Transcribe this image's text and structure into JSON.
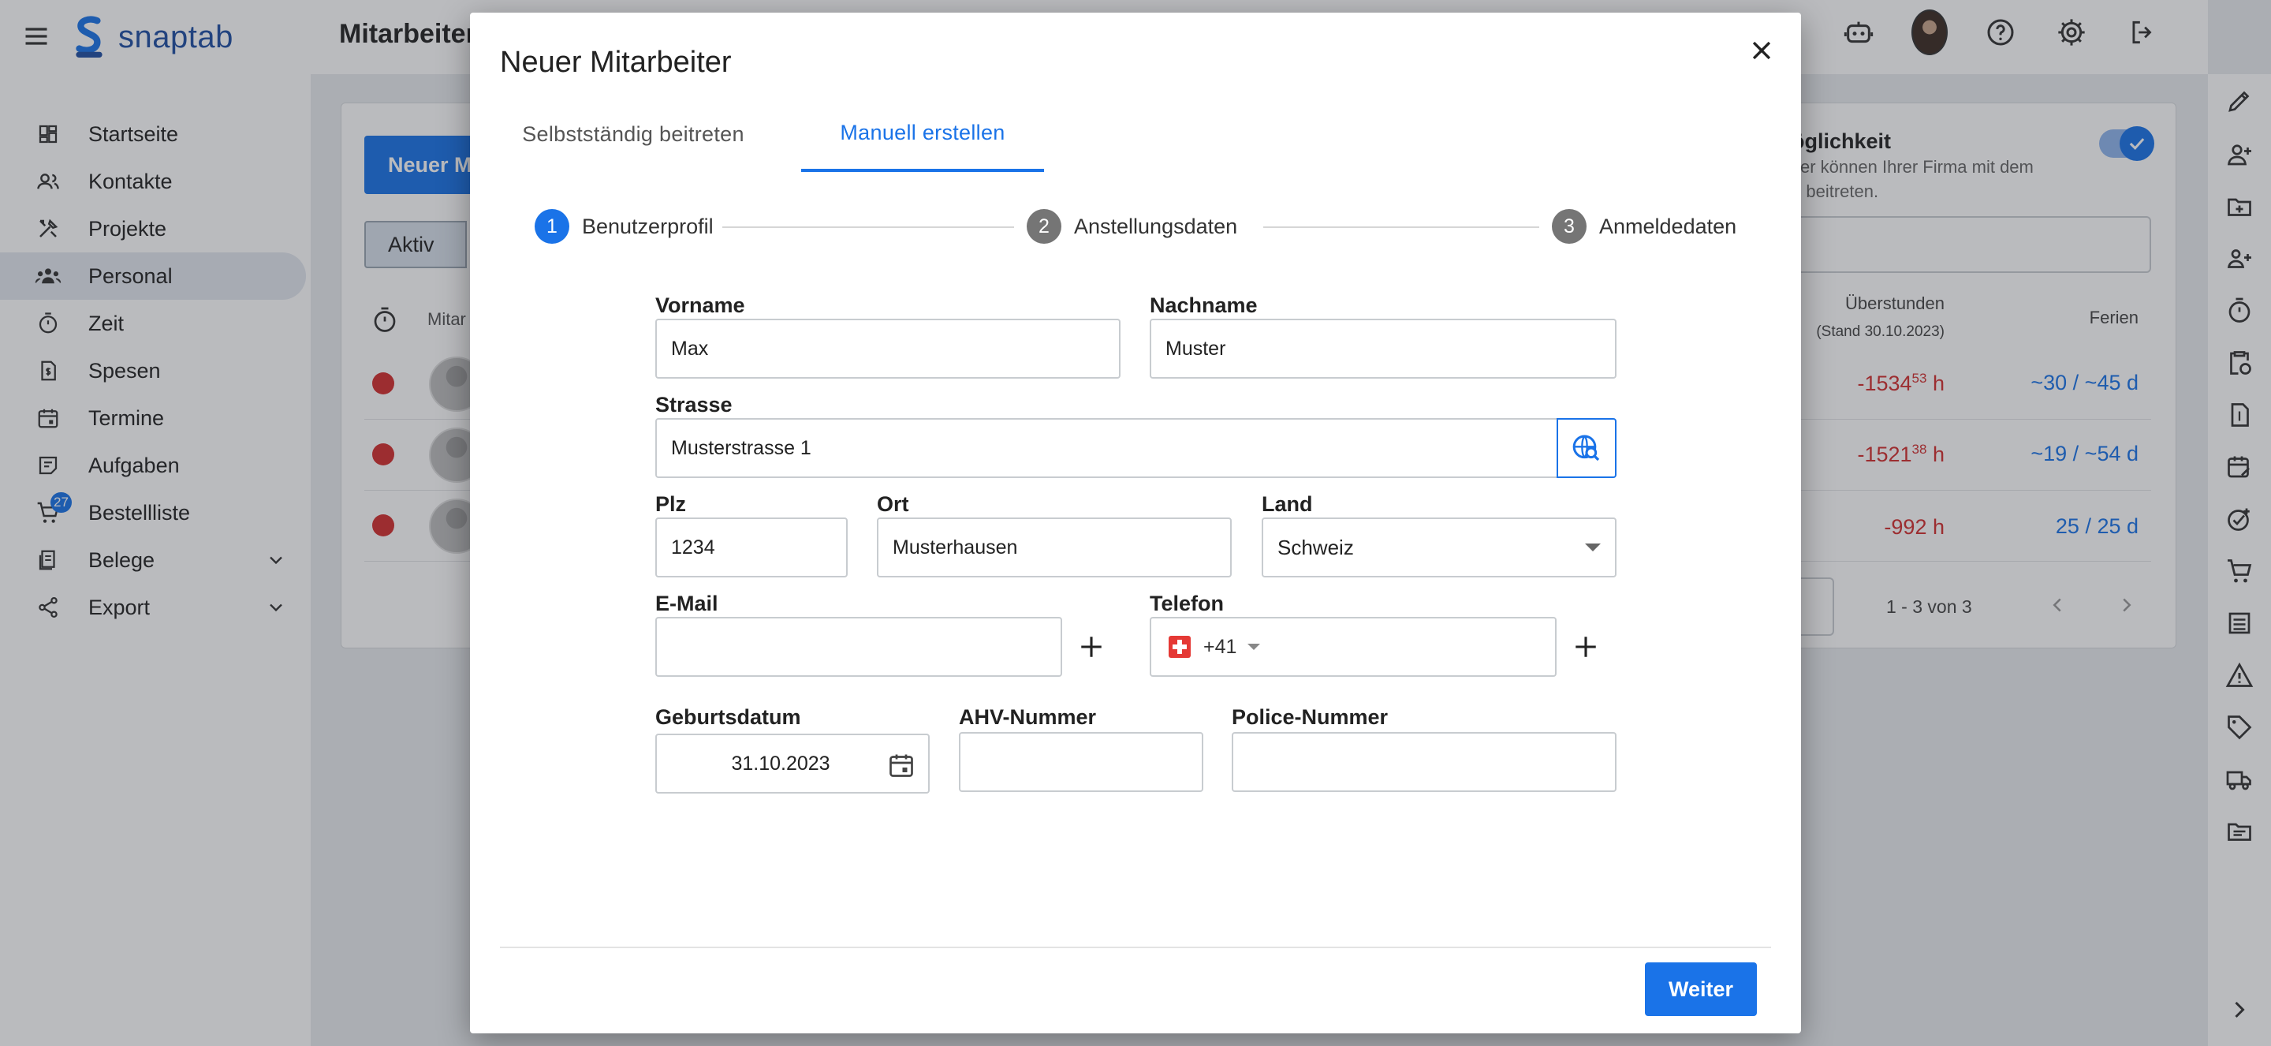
{
  "app": {
    "brand": "snaptab",
    "page_title": "Mitarbeiter",
    "accent_color": "#1a73e8"
  },
  "topbar": {
    "icons": [
      "bell-icon",
      "robot-icon",
      "user-avatar",
      "help-icon",
      "gear-icon",
      "logout-icon"
    ]
  },
  "sidebar": {
    "items": [
      {
        "label": "Startseite",
        "icon": "dashboard-icon"
      },
      {
        "label": "Kontakte",
        "icon": "contacts-icon"
      },
      {
        "label": "Projekte",
        "icon": "tools-icon"
      },
      {
        "label": "Personal",
        "icon": "people-icon"
      },
      {
        "label": "Zeit",
        "icon": "stopwatch-icon"
      },
      {
        "label": "Spesen",
        "icon": "receipt-icon"
      },
      {
        "label": "Termine",
        "icon": "calendar-icon"
      },
      {
        "label": "Aufgaben",
        "icon": "tasks-icon"
      },
      {
        "label": "Bestellliste",
        "icon": "cart-icon",
        "badge": "27"
      },
      {
        "label": "Belege",
        "icon": "documents-icon"
      },
      {
        "label": "Export",
        "icon": "share-icon"
      }
    ]
  },
  "background": {
    "new_button": "Neuer M",
    "segment_active": "Aktiv",
    "col_employee": "Mitar",
    "join_title": "öglichkeit",
    "join_text_1": "zer können Ihrer Firma mit dem",
    "join_text_2": "e beitreten.",
    "th_overtime": "Überstunden",
    "th_overtime_stand": "(Stand 30.10.2023)",
    "th_vacation": "Ferien",
    "rows": [
      {
        "hours": "-1534",
        "hours_sup": "53",
        "hours_unit": " h",
        "vacation": "~30 / ~45 d"
      },
      {
        "hours": "-1521",
        "hours_sup": "38",
        "hours_unit": " h",
        "vacation": "~19 / ~54 d"
      },
      {
        "hours": "-992",
        "hours_sup": "",
        "hours_unit": " h",
        "vacation": "25 / 25 d"
      }
    ],
    "pagination": "1 - 3 von 3"
  },
  "modal": {
    "title": "Neuer Mitarbeiter",
    "tabs": {
      "self_join": "Selbstständig beitreten",
      "manual": "Manuell erstellen"
    },
    "steps": [
      {
        "number": "1",
        "label": "Benutzerprofil"
      },
      {
        "number": "2",
        "label": "Anstellungsdaten"
      },
      {
        "number": "3",
        "label": "Anmeldedaten"
      }
    ],
    "fields": {
      "first_name_label": "Vorname",
      "first_name_value": "Max",
      "last_name_label": "Nachname",
      "last_name_value": "Muster",
      "street_label": "Strasse",
      "street_value": "Musterstrasse 1",
      "zip_label": "Plz",
      "zip_value": "1234",
      "city_label": "Ort",
      "city_value": "Musterhausen",
      "country_label": "Land",
      "country_value": "Schweiz",
      "email_label": "E-Mail",
      "email_value": "",
      "phone_label": "Telefon",
      "phone_code": "+41",
      "phone_value": "",
      "birthdate_label": "Geburtsdatum",
      "birthdate_value": "31.10.2023",
      "ahv_label": "AHV-Nummer",
      "ahv_value": "",
      "police_label": "Police-Nummer",
      "police_value": ""
    },
    "next_button": "Weiter"
  }
}
